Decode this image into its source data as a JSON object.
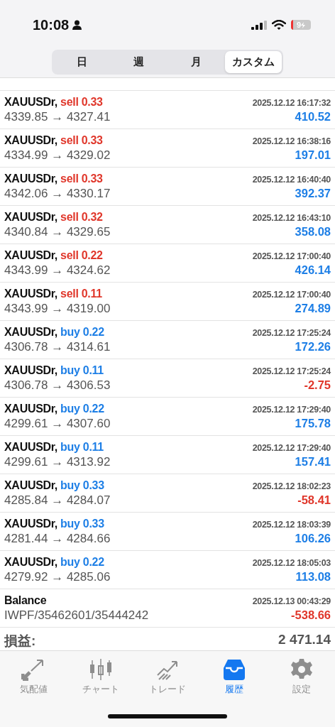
{
  "status_bar": {
    "time": "10:08",
    "battery": "9"
  },
  "period_tabs": [
    {
      "label": "日",
      "selected": false
    },
    {
      "label": "週",
      "selected": false
    },
    {
      "label": "月",
      "selected": false
    },
    {
      "label": "カスタム",
      "selected": true
    }
  ],
  "history": [
    {
      "kind": "trade",
      "symbol": "XAUUSDr,",
      "side": "sell",
      "volume": "0.33",
      "time": "2025.12.12 16:17:32",
      "prices": "4339.85 → 4327.41",
      "profit": "410.52",
      "loss": false
    },
    {
      "kind": "trade",
      "symbol": "XAUUSDr,",
      "side": "sell",
      "volume": "0.33",
      "time": "2025.12.12 16:38:16",
      "prices": "4334.99 → 4329.02",
      "profit": "197.01",
      "loss": false
    },
    {
      "kind": "trade",
      "symbol": "XAUUSDr,",
      "side": "sell",
      "volume": "0.33",
      "time": "2025.12.12 16:40:40",
      "prices": "4342.06 → 4330.17",
      "profit": "392.37",
      "loss": false
    },
    {
      "kind": "trade",
      "symbol": "XAUUSDr,",
      "side": "sell",
      "volume": "0.32",
      "time": "2025.12.12 16:43:10",
      "prices": "4340.84 → 4329.65",
      "profit": "358.08",
      "loss": false
    },
    {
      "kind": "trade",
      "symbol": "XAUUSDr,",
      "side": "sell",
      "volume": "0.22",
      "time": "2025.12.12 17:00:40",
      "prices": "4343.99 → 4324.62",
      "profit": "426.14",
      "loss": false
    },
    {
      "kind": "trade",
      "symbol": "XAUUSDr,",
      "side": "sell",
      "volume": "0.11",
      "time": "2025.12.12 17:00:40",
      "prices": "4343.99 → 4319.00",
      "profit": "274.89",
      "loss": false
    },
    {
      "kind": "trade",
      "symbol": "XAUUSDr,",
      "side": "buy",
      "volume": "0.22",
      "time": "2025.12.12 17:25:24",
      "prices": "4306.78 → 4314.61",
      "profit": "172.26",
      "loss": false
    },
    {
      "kind": "trade",
      "symbol": "XAUUSDr,",
      "side": "buy",
      "volume": "0.11",
      "time": "2025.12.12 17:25:24",
      "prices": "4306.78 → 4306.53",
      "profit": "-2.75",
      "loss": true
    },
    {
      "kind": "trade",
      "symbol": "XAUUSDr,",
      "side": "buy",
      "volume": "0.22",
      "time": "2025.12.12 17:29:40",
      "prices": "4299.61 → 4307.60",
      "profit": "175.78",
      "loss": false
    },
    {
      "kind": "trade",
      "symbol": "XAUUSDr,",
      "side": "buy",
      "volume": "0.11",
      "time": "2025.12.12 17:29:40",
      "prices": "4299.61 → 4313.92",
      "profit": "157.41",
      "loss": false
    },
    {
      "kind": "trade",
      "symbol": "XAUUSDr,",
      "side": "buy",
      "volume": "0.33",
      "time": "2025.12.12 18:02:23",
      "prices": "4285.84 → 4284.07",
      "profit": "-58.41",
      "loss": true
    },
    {
      "kind": "trade",
      "symbol": "XAUUSDr,",
      "side": "buy",
      "volume": "0.33",
      "time": "2025.12.12 18:03:39",
      "prices": "4281.44 → 4284.66",
      "profit": "106.26",
      "loss": false
    },
    {
      "kind": "trade",
      "symbol": "XAUUSDr,",
      "side": "buy",
      "volume": "0.22",
      "time": "2025.12.12 18:05:03",
      "prices": "4279.92 → 4285.06",
      "profit": "113.08",
      "loss": false
    },
    {
      "kind": "balance",
      "symbol": "Balance",
      "time": "2025.12.13 00:43:29",
      "prices": "IWPF/35462601/35444242",
      "profit": "-538.66",
      "loss": true
    }
  ],
  "summary": {
    "label": "損益:",
    "value": "2 471.14"
  },
  "tab_bar": [
    {
      "kind": "quotes",
      "label": "気配値",
      "selected": false
    },
    {
      "kind": "chart",
      "label": "チャート",
      "selected": false
    },
    {
      "kind": "trade",
      "label": "トレード",
      "selected": false
    },
    {
      "kind": "history",
      "label": "履歴",
      "selected": true
    },
    {
      "kind": "settings",
      "label": "設定",
      "selected": false
    }
  ]
}
